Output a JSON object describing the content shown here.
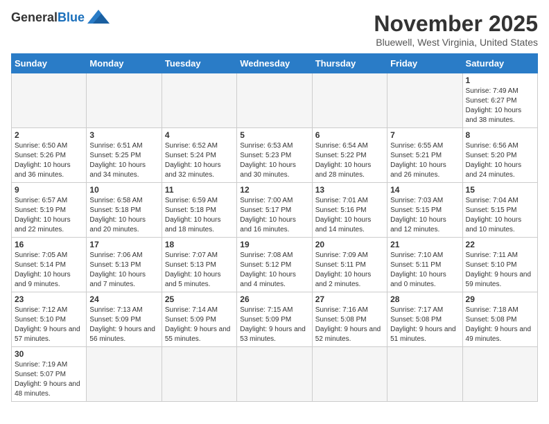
{
  "logo": {
    "general": "General",
    "blue": "Blue"
  },
  "header": {
    "month": "November 2025",
    "location": "Bluewell, West Virginia, United States"
  },
  "weekdays": [
    "Sunday",
    "Monday",
    "Tuesday",
    "Wednesday",
    "Thursday",
    "Friday",
    "Saturday"
  ],
  "days": [
    {
      "num": "",
      "info": ""
    },
    {
      "num": "",
      "info": ""
    },
    {
      "num": "",
      "info": ""
    },
    {
      "num": "",
      "info": ""
    },
    {
      "num": "",
      "info": ""
    },
    {
      "num": "",
      "info": ""
    },
    {
      "num": "1",
      "info": "Sunrise: 7:49 AM\nSunset: 6:27 PM\nDaylight: 10 hours and 38 minutes."
    },
    {
      "num": "2",
      "info": "Sunrise: 6:50 AM\nSunset: 5:26 PM\nDaylight: 10 hours and 36 minutes."
    },
    {
      "num": "3",
      "info": "Sunrise: 6:51 AM\nSunset: 5:25 PM\nDaylight: 10 hours and 34 minutes."
    },
    {
      "num": "4",
      "info": "Sunrise: 6:52 AM\nSunset: 5:24 PM\nDaylight: 10 hours and 32 minutes."
    },
    {
      "num": "5",
      "info": "Sunrise: 6:53 AM\nSunset: 5:23 PM\nDaylight: 10 hours and 30 minutes."
    },
    {
      "num": "6",
      "info": "Sunrise: 6:54 AM\nSunset: 5:22 PM\nDaylight: 10 hours and 28 minutes."
    },
    {
      "num": "7",
      "info": "Sunrise: 6:55 AM\nSunset: 5:21 PM\nDaylight: 10 hours and 26 minutes."
    },
    {
      "num": "8",
      "info": "Sunrise: 6:56 AM\nSunset: 5:20 PM\nDaylight: 10 hours and 24 minutes."
    },
    {
      "num": "9",
      "info": "Sunrise: 6:57 AM\nSunset: 5:19 PM\nDaylight: 10 hours and 22 minutes."
    },
    {
      "num": "10",
      "info": "Sunrise: 6:58 AM\nSunset: 5:18 PM\nDaylight: 10 hours and 20 minutes."
    },
    {
      "num": "11",
      "info": "Sunrise: 6:59 AM\nSunset: 5:18 PM\nDaylight: 10 hours and 18 minutes."
    },
    {
      "num": "12",
      "info": "Sunrise: 7:00 AM\nSunset: 5:17 PM\nDaylight: 10 hours and 16 minutes."
    },
    {
      "num": "13",
      "info": "Sunrise: 7:01 AM\nSunset: 5:16 PM\nDaylight: 10 hours and 14 minutes."
    },
    {
      "num": "14",
      "info": "Sunrise: 7:03 AM\nSunset: 5:15 PM\nDaylight: 10 hours and 12 minutes."
    },
    {
      "num": "15",
      "info": "Sunrise: 7:04 AM\nSunset: 5:15 PM\nDaylight: 10 hours and 10 minutes."
    },
    {
      "num": "16",
      "info": "Sunrise: 7:05 AM\nSunset: 5:14 PM\nDaylight: 10 hours and 9 minutes."
    },
    {
      "num": "17",
      "info": "Sunrise: 7:06 AM\nSunset: 5:13 PM\nDaylight: 10 hours and 7 minutes."
    },
    {
      "num": "18",
      "info": "Sunrise: 7:07 AM\nSunset: 5:13 PM\nDaylight: 10 hours and 5 minutes."
    },
    {
      "num": "19",
      "info": "Sunrise: 7:08 AM\nSunset: 5:12 PM\nDaylight: 10 hours and 4 minutes."
    },
    {
      "num": "20",
      "info": "Sunrise: 7:09 AM\nSunset: 5:11 PM\nDaylight: 10 hours and 2 minutes."
    },
    {
      "num": "21",
      "info": "Sunrise: 7:10 AM\nSunset: 5:11 PM\nDaylight: 10 hours and 0 minutes."
    },
    {
      "num": "22",
      "info": "Sunrise: 7:11 AM\nSunset: 5:10 PM\nDaylight: 9 hours and 59 minutes."
    },
    {
      "num": "23",
      "info": "Sunrise: 7:12 AM\nSunset: 5:10 PM\nDaylight: 9 hours and 57 minutes."
    },
    {
      "num": "24",
      "info": "Sunrise: 7:13 AM\nSunset: 5:09 PM\nDaylight: 9 hours and 56 minutes."
    },
    {
      "num": "25",
      "info": "Sunrise: 7:14 AM\nSunset: 5:09 PM\nDaylight: 9 hours and 55 minutes."
    },
    {
      "num": "26",
      "info": "Sunrise: 7:15 AM\nSunset: 5:09 PM\nDaylight: 9 hours and 53 minutes."
    },
    {
      "num": "27",
      "info": "Sunrise: 7:16 AM\nSunset: 5:08 PM\nDaylight: 9 hours and 52 minutes."
    },
    {
      "num": "28",
      "info": "Sunrise: 7:17 AM\nSunset: 5:08 PM\nDaylight: 9 hours and 51 minutes."
    },
    {
      "num": "29",
      "info": "Sunrise: 7:18 AM\nSunset: 5:08 PM\nDaylight: 9 hours and 49 minutes."
    },
    {
      "num": "30",
      "info": "Sunrise: 7:19 AM\nSunset: 5:07 PM\nDaylight: 9 hours and 48 minutes."
    },
    {
      "num": "",
      "info": ""
    },
    {
      "num": "",
      "info": ""
    },
    {
      "num": "",
      "info": ""
    },
    {
      "num": "",
      "info": ""
    },
    {
      "num": "",
      "info": ""
    },
    {
      "num": "",
      "info": ""
    }
  ]
}
